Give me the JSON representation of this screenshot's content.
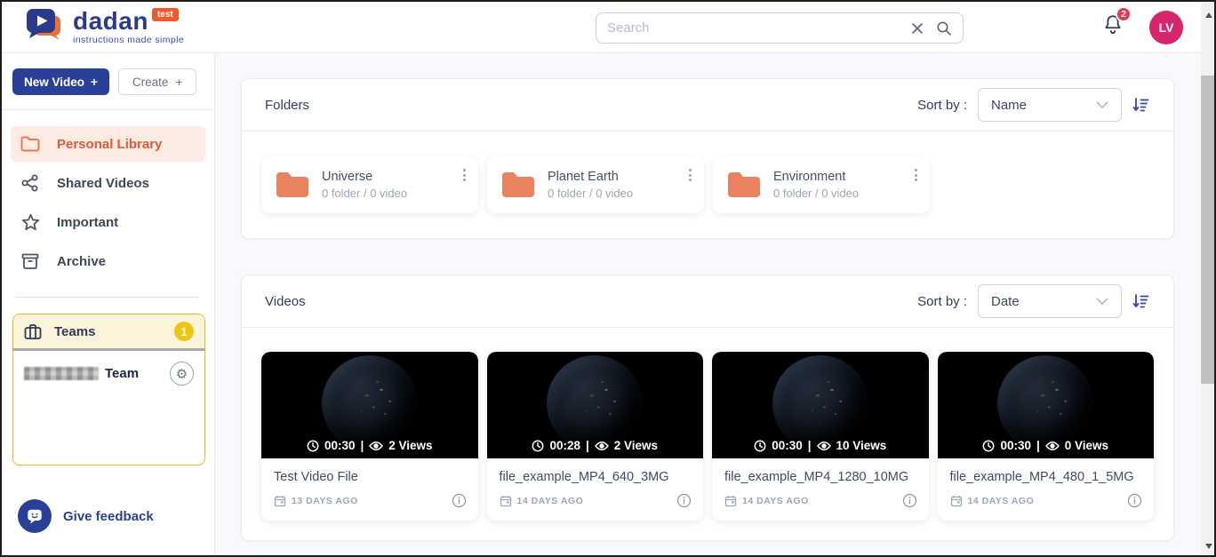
{
  "topbar": {
    "logo_text": "dadan",
    "logo_badge": "test",
    "tagline": "instructions made simple",
    "search": {
      "placeholder": "Search",
      "value": ""
    },
    "notifications_count": "2",
    "avatar_initials": "LV"
  },
  "sidebar": {
    "new_video_label": "New Video",
    "create_label": "Create",
    "plus": "+",
    "nav": [
      {
        "label": "Personal Library"
      },
      {
        "label": "Shared Videos"
      },
      {
        "label": "Important"
      },
      {
        "label": "Archive"
      }
    ],
    "teams": {
      "label": "Teams",
      "count": "1",
      "team_suffix": "Team",
      "gear_glyph": "⚙"
    },
    "feedback_label": "Give feedback"
  },
  "folders_section": {
    "title": "Folders",
    "sort_label": "Sort by :",
    "sort_value": "Name",
    "items": [
      {
        "name": "Universe",
        "meta": "0 folder / 0 video"
      },
      {
        "name": "Planet Earth",
        "meta": "0 folder / 0 video"
      },
      {
        "name": "Environment",
        "meta": "0 folder / 0 video"
      }
    ]
  },
  "videos_section": {
    "title": "Videos",
    "sort_label": "Sort by :",
    "sort_value": "Date",
    "meta_separator": "|",
    "items": [
      {
        "title": "Test Video File",
        "duration": "00:30",
        "views": "2 Views",
        "date": "13 DAYS AGO"
      },
      {
        "title": "file_example_MP4_640_3MG",
        "duration": "00:28",
        "views": "2 Views",
        "date": "14 DAYS AGO"
      },
      {
        "title": "file_example_MP4_1280_10MG",
        "duration": "00:30",
        "views": "10 Views",
        "date": "14 DAYS AGO"
      },
      {
        "title": "file_example_MP4_480_1_5MG",
        "duration": "00:30",
        "views": "0 Views",
        "date": "14 DAYS AGO"
      }
    ]
  },
  "colors": {
    "primary_blue": "#2a3f97",
    "logo_blue": "#2b3a8c",
    "accent_orange": "#e8825f",
    "active_orange_text": "#e05a3a",
    "active_orange_bg": "#fcebe2",
    "teams_yellow_border": "#e5b920",
    "teams_badge_yellow": "#eec60f",
    "notification_red": "#e8374f",
    "avatar_pink": "#d6246e"
  }
}
